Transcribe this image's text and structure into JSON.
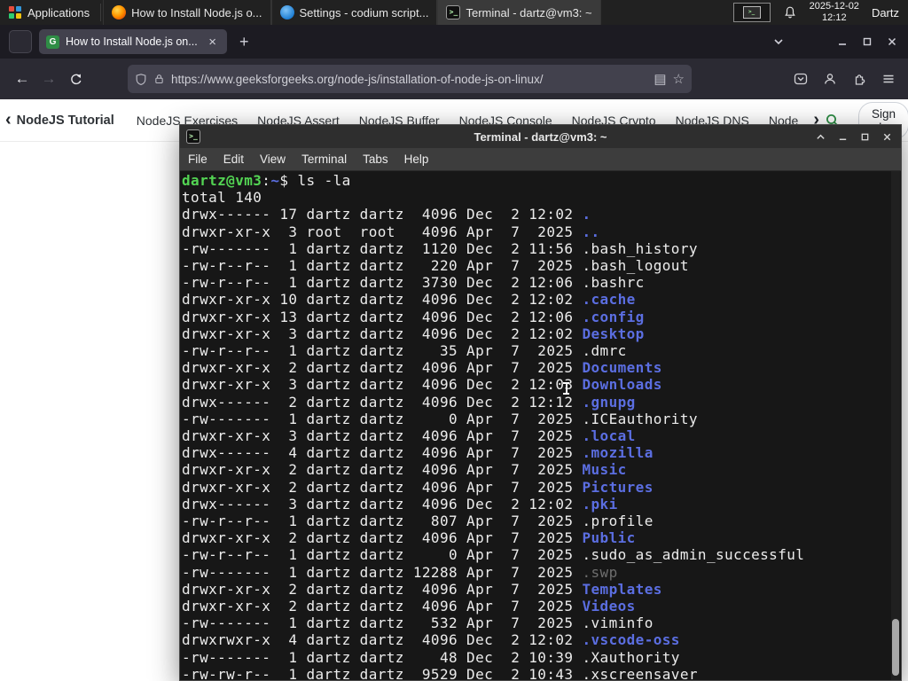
{
  "panel": {
    "applications_label": "Applications",
    "tasks": [
      {
        "title": "How to Install Node.js o..."
      },
      {
        "title": "Settings - codium script..."
      },
      {
        "title": "Terminal - dartz@vm3: ~"
      }
    ],
    "clock_date": "2025-12-02",
    "clock_time": "12:12",
    "user_label": "Dartz"
  },
  "browser": {
    "tab_title": "How to Install Node.js on...",
    "tab_favicon_letter": "G",
    "close_glyph": "×",
    "new_tab_glyph": "+",
    "back_glyph": "←",
    "forward_glyph": "→",
    "reader_glyph": "▤",
    "star_glyph": "☆",
    "url": "https://www.geeksforgeeks.org/node-js/installation-of-node-js-on-linux/"
  },
  "site": {
    "nav_items": [
      "NodeJS Tutorial",
      "NodeJS Exercises",
      "NodeJS Assert",
      "NodeJS Buffer",
      "NodeJS Console",
      "NodeJS Crypto",
      "NodeJS DNS",
      "Node"
    ],
    "chevron_left": "‹",
    "chevron_right": "›",
    "sign_in_label": "Sign In"
  },
  "terminal": {
    "window_title": "Terminal - dartz@vm3: ~",
    "app_icon_glyph": ">_",
    "menu_items": [
      "File",
      "Edit",
      "View",
      "Terminal",
      "Tabs",
      "Help"
    ],
    "prompt_user_host": "dartz@vm3",
    "prompt_colon": ":",
    "prompt_path": "~",
    "prompt_symbol": "$",
    "command": "ls -la",
    "output_total": "total 140",
    "listing": [
      {
        "pre": "drwx------ 17 dartz dartz  4096 Dec  2 12:02 ",
        "name": ".",
        "type": "dir"
      },
      {
        "pre": "drwxr-xr-x  3 root  root   4096 Apr  7  2025 ",
        "name": "..",
        "type": "dir"
      },
      {
        "pre": "-rw-------  1 dartz dartz  1120 Dec  2 11:56 ",
        "name": ".bash_history",
        "type": "plain"
      },
      {
        "pre": "-rw-r--r--  1 dartz dartz   220 Apr  7  2025 ",
        "name": ".bash_logout",
        "type": "plain"
      },
      {
        "pre": "-rw-r--r--  1 dartz dartz  3730 Dec  2 12:06 ",
        "name": ".bashrc",
        "type": "plain"
      },
      {
        "pre": "drwxr-xr-x 10 dartz dartz  4096 Dec  2 12:02 ",
        "name": ".cache",
        "type": "dir"
      },
      {
        "pre": "drwxr-xr-x 13 dartz dartz  4096 Dec  2 12:06 ",
        "name": ".config",
        "type": "dir"
      },
      {
        "pre": "drwxr-xr-x  3 dartz dartz  4096 Dec  2 12:02 ",
        "name": "Desktop",
        "type": "dir"
      },
      {
        "pre": "-rw-r--r--  1 dartz dartz    35 Apr  7  2025 ",
        "name": ".dmrc",
        "type": "plain"
      },
      {
        "pre": "drwxr-xr-x  2 dartz dartz  4096 Apr  7  2025 ",
        "name": "Documents",
        "type": "dir"
      },
      {
        "pre": "drwxr-xr-x  3 dartz dartz  4096 Dec  2 12:03 ",
        "name": "Downloads",
        "type": "dir"
      },
      {
        "pre": "drwx------  2 dartz dartz  4096 Dec  2 12:12 ",
        "name": ".gnupg",
        "type": "dir"
      },
      {
        "pre": "-rw-------  1 dartz dartz     0 Apr  7  2025 ",
        "name": ".ICEauthority",
        "type": "plain"
      },
      {
        "pre": "drwxr-xr-x  3 dartz dartz  4096 Apr  7  2025 ",
        "name": ".local",
        "type": "dir"
      },
      {
        "pre": "drwx------  4 dartz dartz  4096 Apr  7  2025 ",
        "name": ".mozilla",
        "type": "dir"
      },
      {
        "pre": "drwxr-xr-x  2 dartz dartz  4096 Apr  7  2025 ",
        "name": "Music",
        "type": "dir"
      },
      {
        "pre": "drwxr-xr-x  2 dartz dartz  4096 Apr  7  2025 ",
        "name": "Pictures",
        "type": "dir"
      },
      {
        "pre": "drwx------  3 dartz dartz  4096 Dec  2 12:02 ",
        "name": ".pki",
        "type": "dir"
      },
      {
        "pre": "-rw-r--r--  1 dartz dartz   807 Apr  7  2025 ",
        "name": ".profile",
        "type": "plain"
      },
      {
        "pre": "drwxr-xr-x  2 dartz dartz  4096 Apr  7  2025 ",
        "name": "Public",
        "type": "dir"
      },
      {
        "pre": "-rw-r--r--  1 dartz dartz     0 Apr  7  2025 ",
        "name": ".sudo_as_admin_successful",
        "type": "plain"
      },
      {
        "pre": "-rw-------  1 dartz dartz 12288 Apr  7  2025 ",
        "name": ".swp",
        "type": "dim"
      },
      {
        "pre": "drwxr-xr-x  2 dartz dartz  4096 Apr  7  2025 ",
        "name": "Templates",
        "type": "dir"
      },
      {
        "pre": "drwxr-xr-x  2 dartz dartz  4096 Apr  7  2025 ",
        "name": "Videos",
        "type": "dir"
      },
      {
        "pre": "-rw-------  1 dartz dartz   532 Apr  7  2025 ",
        "name": ".viminfo",
        "type": "plain"
      },
      {
        "pre": "drwxrwxr-x  4 dartz dartz  4096 Dec  2 12:02 ",
        "name": ".vscode-oss",
        "type": "dir"
      },
      {
        "pre": "-rw-------  1 dartz dartz    48 Dec  2 10:39 ",
        "name": ".Xauthority",
        "type": "plain"
      },
      {
        "pre": "-rw-rw-r--  1 dartz dartz  9529 Dec  2 10:43 ",
        "name": ".xscreensaver",
        "type": "plain"
      }
    ]
  },
  "colors": {
    "gfg_green": "#2f8d46",
    "terminal_dir_blue": "#5b6ee1",
    "terminal_prompt_green": "#53d453",
    "terminal_background": "#171717"
  }
}
